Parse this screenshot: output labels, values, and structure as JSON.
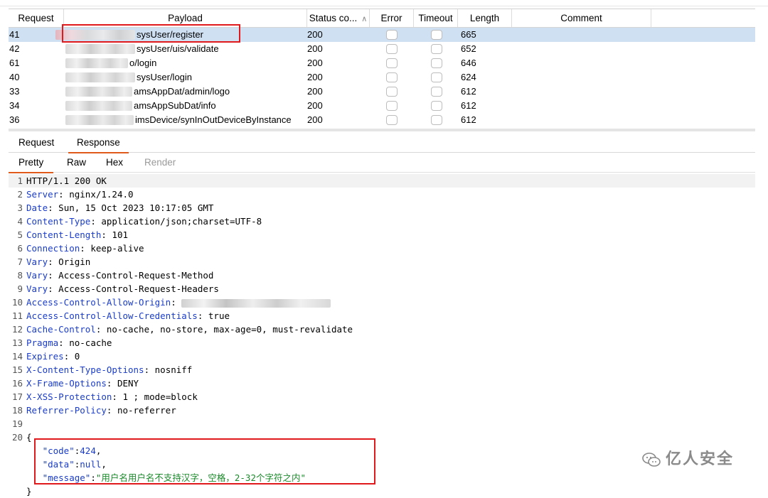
{
  "table": {
    "headers": {
      "request": "Request",
      "payload": "Payload",
      "status": "Status co...",
      "error": "Error",
      "timeout": "Timeout",
      "length": "Length",
      "comment": "Comment"
    },
    "rows": [
      {
        "request": "41",
        "payload": "sysUser/register",
        "status": "200",
        "length": "665",
        "selected": true
      },
      {
        "request": "42",
        "payload": "sysUser/uis/validate",
        "status": "200",
        "length": "652"
      },
      {
        "request": "61",
        "payload": "o/login",
        "status": "200",
        "length": "646"
      },
      {
        "request": "40",
        "payload": "sysUser/login",
        "status": "200",
        "length": "624"
      },
      {
        "request": "33",
        "payload": "amsAppDat/admin/logo",
        "status": "200",
        "length": "612"
      },
      {
        "request": "34",
        "payload": "amsAppSubDat/info",
        "status": "200",
        "length": "612"
      },
      {
        "request": "36",
        "payload": "imsDevice/synInOutDeviceByInstance",
        "status": "200",
        "length": "612"
      }
    ]
  },
  "message_tabs": {
    "request": "Request",
    "response": "Response"
  },
  "view_tabs": {
    "pretty": "Pretty",
    "raw": "Raw",
    "hex": "Hex",
    "render": "Render"
  },
  "response": {
    "status_line": "HTTP/1.1 200 OK",
    "headers": [
      {
        "name": "Server",
        "value": "nginx/1.24.0"
      },
      {
        "name": "Date",
        "value": "Sun, 15 Oct 2023 10:17:05 GMT"
      },
      {
        "name": "Content-Type",
        "value": "application/json;charset=UTF-8"
      },
      {
        "name": "Content-Length",
        "value": "101"
      },
      {
        "name": "Connection",
        "value": "keep-alive"
      },
      {
        "name": "Vary",
        "value": "Origin"
      },
      {
        "name": "Vary",
        "value": "Access-Control-Request-Method"
      },
      {
        "name": "Vary",
        "value": "Access-Control-Request-Headers"
      },
      {
        "name": "Access-Control-Allow-Origin",
        "value": ""
      },
      {
        "name": "Access-Control-Allow-Credentials",
        "value": "true"
      },
      {
        "name": "Cache-Control",
        "value": "no-cache, no-store, max-age=0, must-revalidate"
      },
      {
        "name": "Pragma",
        "value": "no-cache"
      },
      {
        "name": "Expires",
        "value": "0"
      },
      {
        "name": "X-Content-Type-Options",
        "value": "nosniff"
      },
      {
        "name": "X-Frame-Options",
        "value": "DENY"
      },
      {
        "name": "X-XSS-Protection",
        "value": "1 ; mode=block"
      },
      {
        "name": "Referrer-Policy",
        "value": "no-referrer"
      }
    ],
    "body_open": "{",
    "body": {
      "code_key": "\"code\"",
      "code_val": "424",
      "data_key": "\"data\"",
      "data_val": "null",
      "message_key": "\"message\"",
      "message_val": "\"用户名用户名不支持汉字，空格，2-32个字符之内\""
    },
    "body_close": "}"
  },
  "watermark": "亿人安全",
  "colors": {
    "selection": "#cfe0f3",
    "highlight_box": "#e0191c",
    "header_name": "#1a3cc8",
    "json_string": "#1a8a2a",
    "active_tab_underline": "#e05a1c"
  }
}
